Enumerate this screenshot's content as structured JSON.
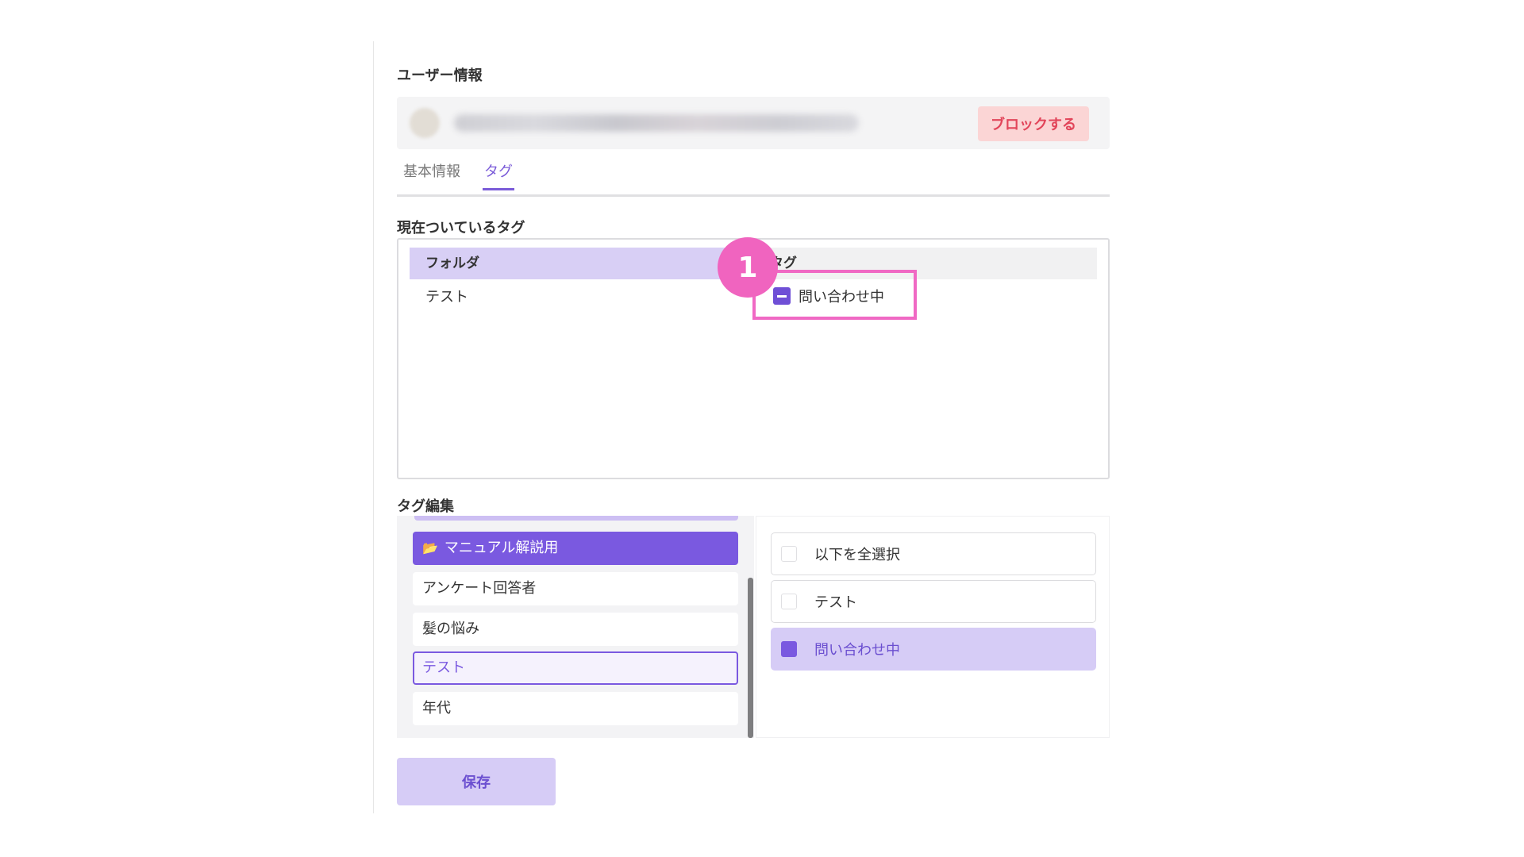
{
  "user_info": {
    "section_title": "ユーザー情報",
    "block_button": "ブロックする"
  },
  "tabs": [
    {
      "label": "基本情報",
      "active": false
    },
    {
      "label": "タグ",
      "active": true
    }
  ],
  "current_tags": {
    "section_title": "現在ついているタグ",
    "header_folder": "フォルダ",
    "header_tag": "タグ",
    "rows": [
      {
        "folder": "テスト",
        "tag": "問い合わせ中"
      }
    ]
  },
  "callout": {
    "number": "1"
  },
  "tag_edit": {
    "section_title": "タグ編集",
    "folders": [
      {
        "label": "マニュアル解説用",
        "state": "active"
      },
      {
        "label": "アンケート回答者",
        "state": "normal"
      },
      {
        "label": "髪の悩み",
        "state": "normal"
      },
      {
        "label": "テスト",
        "state": "outlined"
      },
      {
        "label": "年代",
        "state": "normal"
      }
    ],
    "options": [
      {
        "label": "以下を全選択",
        "checked": false
      },
      {
        "label": "テスト",
        "checked": false
      },
      {
        "label": "問い合わせ中",
        "checked": true
      }
    ]
  },
  "save_button": "保存",
  "colors": {
    "accent": "#7a59e0",
    "accent_light": "#d6ccf6",
    "danger_text": "#e2455a",
    "danger_bg": "#fbd5d5",
    "callout": "#f064bf"
  }
}
